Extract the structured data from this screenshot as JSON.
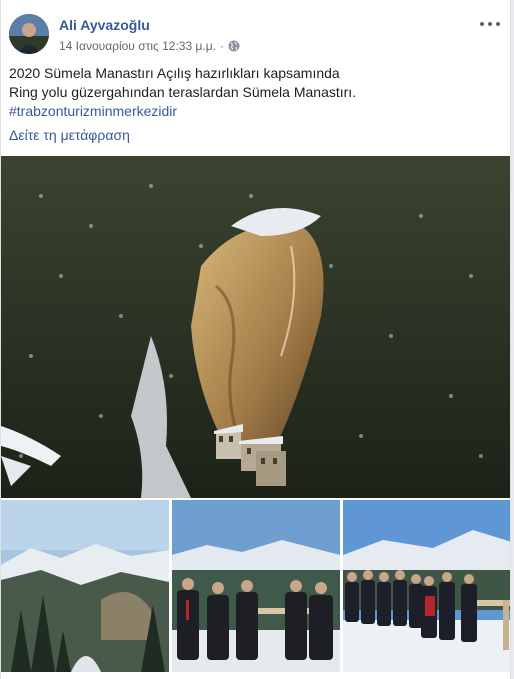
{
  "post": {
    "author": "Ali Ayvazoğlu",
    "timestamp": "14 Ιανουαρίου στις 12:33 μ.μ.",
    "separator": "·",
    "privacy_icon": "globe-icon",
    "more_icon": "more-options-icon",
    "text_line1": "2020 Sümela Manastırı Açılış hazırlıkları kapsamında",
    "text_line2": "Ring yolu güzergahından teraslardan Sümela Manastırı.",
    "hashtag": "#trabzonturizminmerkezidir",
    "translate_link": "Δείτε τη μετάφραση"
  },
  "photos": {
    "main": "monastery-cliff-photo",
    "thumbs": [
      "mountain-view-photo",
      "group-photo-1",
      "group-photo-2"
    ]
  },
  "colors": {
    "link": "#385898",
    "text": "#1c1e21",
    "meta": "#616770",
    "background": "#e9ebee"
  }
}
